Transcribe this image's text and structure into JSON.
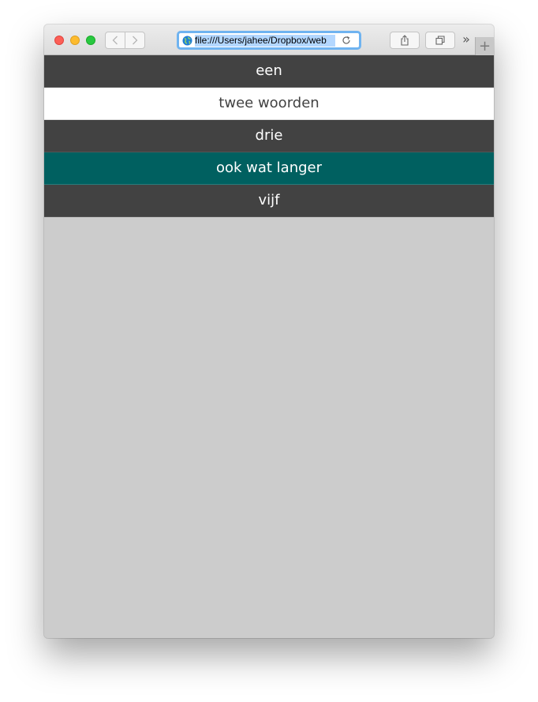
{
  "browser": {
    "url": "file:///Users/jahee/Dropbox/web",
    "new_tab_label": "+",
    "overflow_label": "»",
    "colors": {
      "close": "#fc5f57",
      "minimize": "#fdbb2e",
      "zoom": "#28c840",
      "url_focus_ring": "#6fb3f0"
    }
  },
  "menu": {
    "items": [
      {
        "label": "een",
        "style": "dark"
      },
      {
        "label": "twee woorden",
        "style": "white"
      },
      {
        "label": "drie",
        "style": "dark"
      },
      {
        "label": "ook wat langer",
        "style": "teal"
      },
      {
        "label": "vijf",
        "style": "dark"
      }
    ],
    "colors": {
      "dark": "#424242",
      "white": "#ffffff",
      "teal": "#006060",
      "page_background": "#cccccc"
    }
  }
}
